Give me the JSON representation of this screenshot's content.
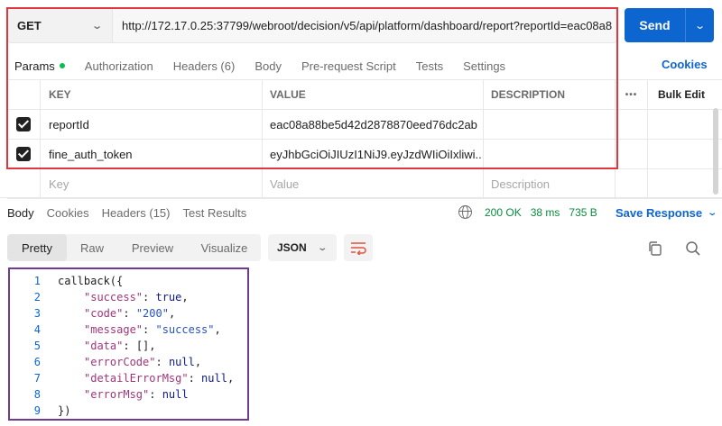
{
  "request": {
    "method": "GET",
    "url": "http://172.17.0.25:37799/webroot/decision/v5/api/platform/dashboard/report?reportId=eac08a8",
    "send_label": "Send"
  },
  "request_tabs": [
    {
      "label": "Params",
      "active": true
    },
    {
      "label": "Authorization"
    },
    {
      "label": "Headers (6)"
    },
    {
      "label": "Body"
    },
    {
      "label": "Pre-request Script"
    },
    {
      "label": "Tests"
    },
    {
      "label": "Settings"
    }
  ],
  "cookies_label": "Cookies",
  "params_table": {
    "headers": {
      "key": "KEY",
      "value": "VALUE",
      "description": "DESCRIPTION",
      "more": "•••",
      "bulk_edit": "Bulk Edit"
    },
    "rows": [
      {
        "checked": true,
        "key": "reportId",
        "value": "eac08a88be5d42d2878870eed76dc2ab",
        "description": ""
      },
      {
        "checked": true,
        "key": "fine_auth_token",
        "value": "eyJhbGciOiJIUzI1NiJ9.eyJzdWIiOiIxliwi...",
        "description": ""
      }
    ],
    "placeholder": {
      "key": "Key",
      "value": "Value",
      "description": "Description"
    }
  },
  "response_tabs": [
    {
      "label": "Body",
      "active": true
    },
    {
      "label": "Cookies"
    },
    {
      "label": "Headers (15)"
    },
    {
      "label": "Test Results"
    }
  ],
  "response_status": {
    "status": "200 OK",
    "time": "38 ms",
    "size": "735 B"
  },
  "save_response_label": "Save Response",
  "view_modes": [
    {
      "label": "Pretty",
      "active": true
    },
    {
      "label": "Raw"
    },
    {
      "label": "Preview"
    },
    {
      "label": "Visualize"
    }
  ],
  "format_label": "JSON",
  "colors": {
    "accent": "#0d66d0",
    "ok": "#0a8a3e",
    "dot": "#0cbb52",
    "highlight_red": "#e0373f",
    "highlight_purple": "#6f3b8e"
  },
  "code": {
    "line_numbers": [
      "1",
      "2",
      "3",
      "4",
      "5",
      "6",
      "7",
      "8",
      "9"
    ],
    "open": "callback({",
    "close": "})",
    "entries": [
      {
        "key": "\"success\"",
        "value": "true",
        "comma": ","
      },
      {
        "key": "\"code\"",
        "value": "\"200\"",
        "comma": ","
      },
      {
        "key": "\"message\"",
        "value": "\"success\"",
        "comma": ","
      },
      {
        "key": "\"data\"",
        "value": "[]",
        "comma": ","
      },
      {
        "key": "\"errorCode\"",
        "value": "null",
        "comma": ","
      },
      {
        "key": "\"detailErrorMsg\"",
        "value": "null",
        "comma": ","
      },
      {
        "key": "\"errorMsg\"",
        "value": "null",
        "comma": ""
      }
    ]
  }
}
